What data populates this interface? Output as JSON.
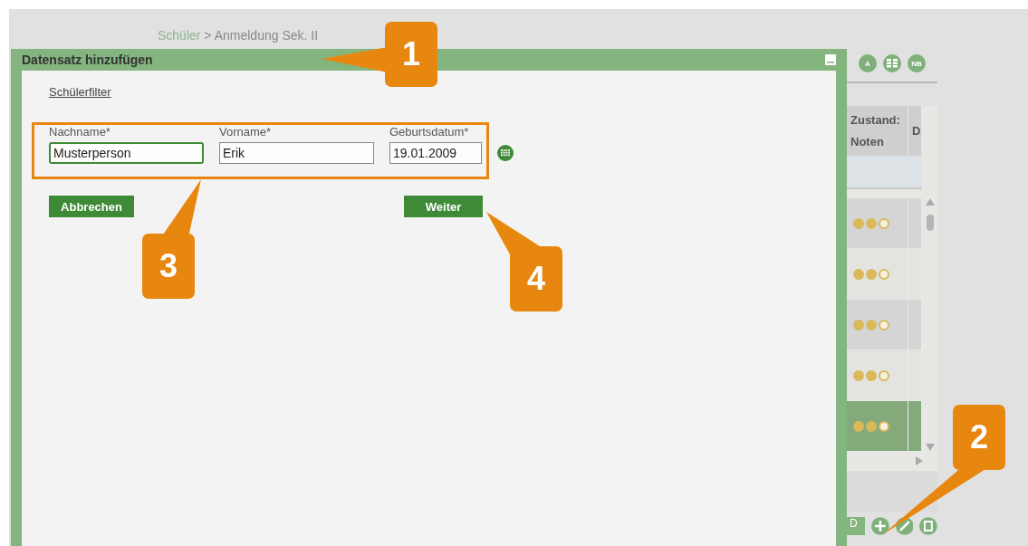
{
  "breadcrumb": {
    "parent": "Schüler",
    "separator": ">",
    "current": "Anmeldung Sek. II"
  },
  "background_table": {
    "toolbar": [
      {
        "kind": "letter",
        "label": "A"
      },
      {
        "kind": "grid"
      },
      {
        "kind": "letter",
        "label": "NB"
      }
    ],
    "columns": [
      "Zustand: Noten",
      "D"
    ],
    "rows": [
      {
        "stars": 2,
        "selected": false
      },
      {
        "stars": 2,
        "selected": false
      },
      {
        "stars": 2,
        "selected": false
      },
      {
        "stars": 2,
        "selected": false
      },
      {
        "stars": 2,
        "selected": true
      }
    ],
    "bottom_tab": "D",
    "actions": [
      {
        "kind": "add"
      },
      {
        "kind": "edit"
      },
      {
        "kind": "delete"
      }
    ]
  },
  "dialog": {
    "title": "Datensatz hinzufügen",
    "filter_link": "Schülerfilter",
    "fields": [
      {
        "label": "Nachname*",
        "value": "Musterperson",
        "focused": true,
        "kind": "text"
      },
      {
        "label": "Vorname*",
        "value": "Erik",
        "focused": false,
        "kind": "text"
      },
      {
        "label": "Geburtsdatum*",
        "value": "19.01.2009",
        "focused": false,
        "kind": "date"
      }
    ],
    "buttons": [
      "Abbrechen",
      "Weiter"
    ]
  },
  "callouts": [
    {
      "number": "1"
    },
    {
      "number": "2"
    },
    {
      "number": "3"
    },
    {
      "number": "4"
    }
  ]
}
